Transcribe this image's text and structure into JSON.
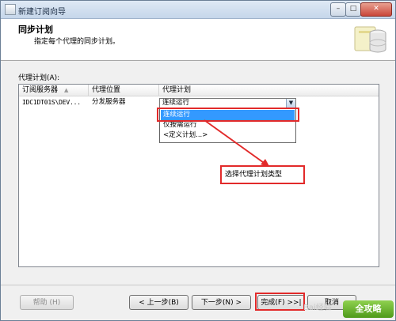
{
  "window": {
    "title": "新建订阅向导",
    "minimize": "–",
    "maximize": "□",
    "close": "✕"
  },
  "header": {
    "title": "同步计划",
    "subtitle": "指定每个代理的同步计划。"
  },
  "content": {
    "group_label": "代理计划(A):",
    "columns": [
      "订阅服务器",
      "代理位置",
      "代理计划"
    ],
    "rows": [
      {
        "subscriber": "IDC1DT01S\\DEV...",
        "location": "分发服务器",
        "schedule": "连续运行"
      }
    ],
    "combo_arrow": "▼",
    "dropdown_options": [
      "连续运行",
      "仅按需运行",
      "<定义计划...>"
    ],
    "callout_text": "选择代理计划类型"
  },
  "footer": {
    "help": "帮助 (H)",
    "back": "< 上一步(B)",
    "next": "下一步(N) >",
    "finish": "完成(F) >>|",
    "cancel": "取消"
  },
  "watermark": {
    "text": "Bai经验",
    "logo": "全攻略"
  },
  "colors": {
    "annotation": "#e22a2a",
    "selection": "#3399ff"
  }
}
